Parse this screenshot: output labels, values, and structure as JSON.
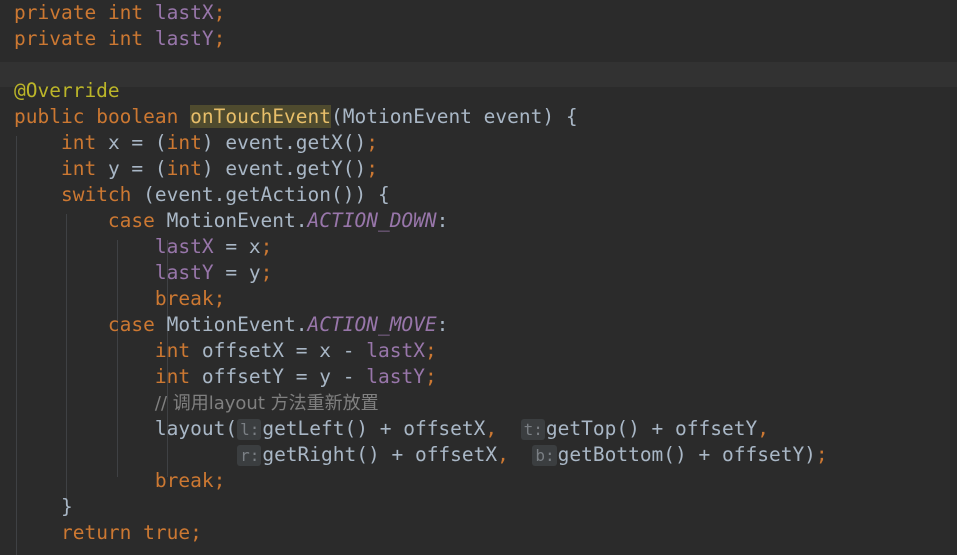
{
  "editor": {
    "theme": "darcula",
    "background": "#2b2b2b",
    "band_background": "#323232",
    "indent_guide_color": "#3f4144",
    "default_text_color": "#a9b7c6",
    "keyword_color": "#cc7832",
    "field_color": "#9876aa",
    "annotation_color": "#bbb529",
    "comment_color": "#808080",
    "highlight_background": "#4f4b2e",
    "highlight_text_color": "#e8bf6a",
    "hint_background": "#3b3e40",
    "hint_text_color": "#7a7f84",
    "language": "Java"
  },
  "code": {
    "lines": [
      {
        "n": 1,
        "text": "private int lastX;",
        "tokens": [
          {
            "t": "private",
            "k": "kw"
          },
          {
            "t": " ",
            "k": "op"
          },
          {
            "t": "int",
            "k": "kw"
          },
          {
            "t": " ",
            "k": "op"
          },
          {
            "t": "lastX",
            "k": "fld"
          },
          {
            "t": ";",
            "k": "punc"
          }
        ]
      },
      {
        "n": 2,
        "text": "private int lastY;",
        "tokens": [
          {
            "t": "private",
            "k": "kw"
          },
          {
            "t": " ",
            "k": "op"
          },
          {
            "t": "int",
            "k": "kw"
          },
          {
            "t": " ",
            "k": "op"
          },
          {
            "t": "lastY",
            "k": "fld"
          },
          {
            "t": ";",
            "k": "punc"
          }
        ]
      },
      {
        "n": 3,
        "text": "",
        "tokens": []
      },
      {
        "n": 4,
        "text": "@Override",
        "tokens": [
          {
            "t": "@Override",
            "k": "anno"
          }
        ]
      },
      {
        "n": 5,
        "text": "public boolean onTouchEvent(MotionEvent event) {",
        "tokens": [
          {
            "t": "public",
            "k": "kw"
          },
          {
            "t": " ",
            "k": "op"
          },
          {
            "t": "boolean",
            "k": "kw"
          },
          {
            "t": " ",
            "k": "op"
          },
          {
            "t": "onTouchEvent",
            "k": "hl"
          },
          {
            "t": "(",
            "k": "op"
          },
          {
            "t": "MotionEvent",
            "k": "cls"
          },
          {
            "t": " event) {",
            "k": "op"
          }
        ]
      },
      {
        "n": 6,
        "text": "    int x = (int) event.getX();",
        "tokens": [
          {
            "t": "    ",
            "k": "op"
          },
          {
            "t": "int",
            "k": "kw"
          },
          {
            "t": " x = (",
            "k": "op"
          },
          {
            "t": "int",
            "k": "kw"
          },
          {
            "t": ") event.getX()",
            "k": "op"
          },
          {
            "t": ";",
            "k": "punc"
          }
        ]
      },
      {
        "n": 7,
        "text": "    int y = (int) event.getY();",
        "tokens": [
          {
            "t": "    ",
            "k": "op"
          },
          {
            "t": "int",
            "k": "kw"
          },
          {
            "t": " y = (",
            "k": "op"
          },
          {
            "t": "int",
            "k": "kw"
          },
          {
            "t": ") event.getY()",
            "k": "op"
          },
          {
            "t": ";",
            "k": "punc"
          }
        ]
      },
      {
        "n": 8,
        "text": "    switch (event.getAction()) {",
        "tokens": [
          {
            "t": "    ",
            "k": "op"
          },
          {
            "t": "switch",
            "k": "kw"
          },
          {
            "t": " (event.getAction()) {",
            "k": "op"
          }
        ]
      },
      {
        "n": 9,
        "text": "        case MotionEvent.ACTION_DOWN:",
        "tokens": [
          {
            "t": "        ",
            "k": "op"
          },
          {
            "t": "case",
            "k": "kw"
          },
          {
            "t": " MotionEvent.",
            "k": "op"
          },
          {
            "t": "ACTION_DOWN",
            "k": "stat"
          },
          {
            "t": ":",
            "k": "op"
          }
        ]
      },
      {
        "n": 10,
        "text": "            lastX = x;",
        "tokens": [
          {
            "t": "            ",
            "k": "op"
          },
          {
            "t": "lastX",
            "k": "fld"
          },
          {
            "t": " = x",
            "k": "op"
          },
          {
            "t": ";",
            "k": "punc"
          }
        ]
      },
      {
        "n": 11,
        "text": "            lastY = y;",
        "tokens": [
          {
            "t": "            ",
            "k": "op"
          },
          {
            "t": "lastY",
            "k": "fld"
          },
          {
            "t": " = y",
            "k": "op"
          },
          {
            "t": ";",
            "k": "punc"
          }
        ]
      },
      {
        "n": 12,
        "text": "            break;",
        "tokens": [
          {
            "t": "            ",
            "k": "op"
          },
          {
            "t": "break",
            "k": "kw"
          },
          {
            "t": ";",
            "k": "punc"
          }
        ]
      },
      {
        "n": 13,
        "text": "        case MotionEvent.ACTION_MOVE:",
        "tokens": [
          {
            "t": "        ",
            "k": "op"
          },
          {
            "t": "case",
            "k": "kw"
          },
          {
            "t": " MotionEvent.",
            "k": "op"
          },
          {
            "t": "ACTION_MOVE",
            "k": "stat"
          },
          {
            "t": ":",
            "k": "op"
          }
        ]
      },
      {
        "n": 14,
        "text": "            int offsetX = x - lastX;",
        "tokens": [
          {
            "t": "            ",
            "k": "op"
          },
          {
            "t": "int",
            "k": "kw"
          },
          {
            "t": " offsetX = x - ",
            "k": "op"
          },
          {
            "t": "lastX",
            "k": "fld"
          },
          {
            "t": ";",
            "k": "punc"
          }
        ]
      },
      {
        "n": 15,
        "text": "            int offsetY = y - lastY;",
        "tokens": [
          {
            "t": "            ",
            "k": "op"
          },
          {
            "t": "int",
            "k": "kw"
          },
          {
            "t": " offsetY = y - ",
            "k": "op"
          },
          {
            "t": "lastY",
            "k": "fld"
          },
          {
            "t": ";",
            "k": "punc"
          }
        ]
      },
      {
        "n": 16,
        "text": "            // 调用layout 方法重新放置",
        "tokens": [
          {
            "t": "            ",
            "k": "op"
          },
          {
            "t": "// 调用layout 方法重新放置",
            "k": "cmt"
          }
        ]
      },
      {
        "n": 17,
        "text": "            layout( l: getLeft() + offsetX,  t: getTop() + offsetY,",
        "tokens": [
          {
            "t": "            layout(",
            "k": "op"
          },
          {
            "t": "l:",
            "k": "hint"
          },
          {
            "t": "getLeft() + offsetX",
            "k": "op"
          },
          {
            "t": ",",
            "k": "punc"
          },
          {
            "t": "  ",
            "k": "op"
          },
          {
            "t": "t:",
            "k": "hint"
          },
          {
            "t": "getTop() + offsetY",
            "k": "op"
          },
          {
            "t": ",",
            "k": "punc"
          }
        ]
      },
      {
        "n": 18,
        "text": "                   r: getRight() + offsetX,  b: getBottom() + offsetY);",
        "tokens": [
          {
            "t": "                   ",
            "k": "op"
          },
          {
            "t": "r:",
            "k": "hint"
          },
          {
            "t": "getRight() + offsetX",
            "k": "op"
          },
          {
            "t": ",",
            "k": "punc"
          },
          {
            "t": "  ",
            "k": "op"
          },
          {
            "t": "b:",
            "k": "hint"
          },
          {
            "t": "getBottom() + offsetY)",
            "k": "op"
          },
          {
            "t": ";",
            "k": "punc"
          }
        ]
      },
      {
        "n": 19,
        "text": "            break;",
        "tokens": [
          {
            "t": "            ",
            "k": "op"
          },
          {
            "t": "break",
            "k": "kw"
          },
          {
            "t": ";",
            "k": "punc"
          }
        ]
      },
      {
        "n": 20,
        "text": "    }",
        "tokens": [
          {
            "t": "    }",
            "k": "op"
          }
        ]
      },
      {
        "n": 21,
        "text": "    return true;",
        "tokens": [
          {
            "t": "    ",
            "k": "op"
          },
          {
            "t": "return",
            "k": "kw"
          },
          {
            "t": " ",
            "k": "op"
          },
          {
            "t": "true",
            "k": "kw"
          },
          {
            "t": ";",
            "k": "punc"
          }
        ]
      }
    ]
  }
}
